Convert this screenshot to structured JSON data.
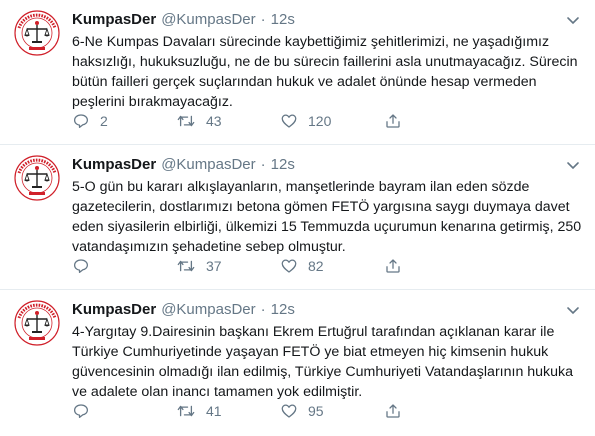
{
  "tweets": [
    {
      "name": "KumpasDer",
      "handle": "@KumpasDer",
      "separator": "·",
      "time": "12s",
      "text": "6-Ne Kumpas Davaları sürecinde kaybettiğimiz şehitlerimizi, ne yaşadığımız haksızlığı, hukuksuzluğu, ne de bu sürecin faillerini asla unutmayacağız. Sürecin bütün failleri gerçek suçlarından hukuk ve adalet önünde hesap vermeden peşlerini bırakmayacağız.",
      "replies": "2",
      "retweets": "43",
      "likes": "120"
    },
    {
      "name": "KumpasDer",
      "handle": "@KumpasDer",
      "separator": "·",
      "time": "12s",
      "text": "5-O gün bu kararı alkışlayanların, manşetlerinde bayram ilan eden sözde gazetecilerin, dostlarımızı betona gömen FETÖ yargısına saygı duymaya davet eden siyasilerin elbirliği, ülkemizi 15 Temmuzda uçurumun kenarına getirmiş, 250 vatandaşımızın şehadetine sebep olmuştur.",
      "replies": "",
      "retweets": "37",
      "likes": "82"
    },
    {
      "name": "KumpasDer",
      "handle": "@KumpasDer",
      "separator": "·",
      "time": "12s",
      "text": "4-Yargıtay 9.Dairesinin başkanı Ekrem Ertuğrul tarafından açıklanan karar ile Türkiye Cumhuriyetinde yaşayan FETÖ ye biat etmeyen hiç kimsenin hukuk güvencesinin olmadığı ilan edilmiş, Türkiye Cumhuriyeti Vatandaşlarının hukuka ve adalete olan inancı tamamen yok edilmiştir.",
      "replies": "",
      "retweets": "41",
      "likes": "95"
    }
  ],
  "colors": {
    "text": "#14171a",
    "muted": "#657786",
    "divider": "#e6ecf0",
    "logo_red": "#d0202a"
  },
  "icons": [
    "avatar-logo",
    "chevron-down-icon",
    "reply-icon",
    "retweet-icon",
    "like-icon",
    "share-icon"
  ]
}
